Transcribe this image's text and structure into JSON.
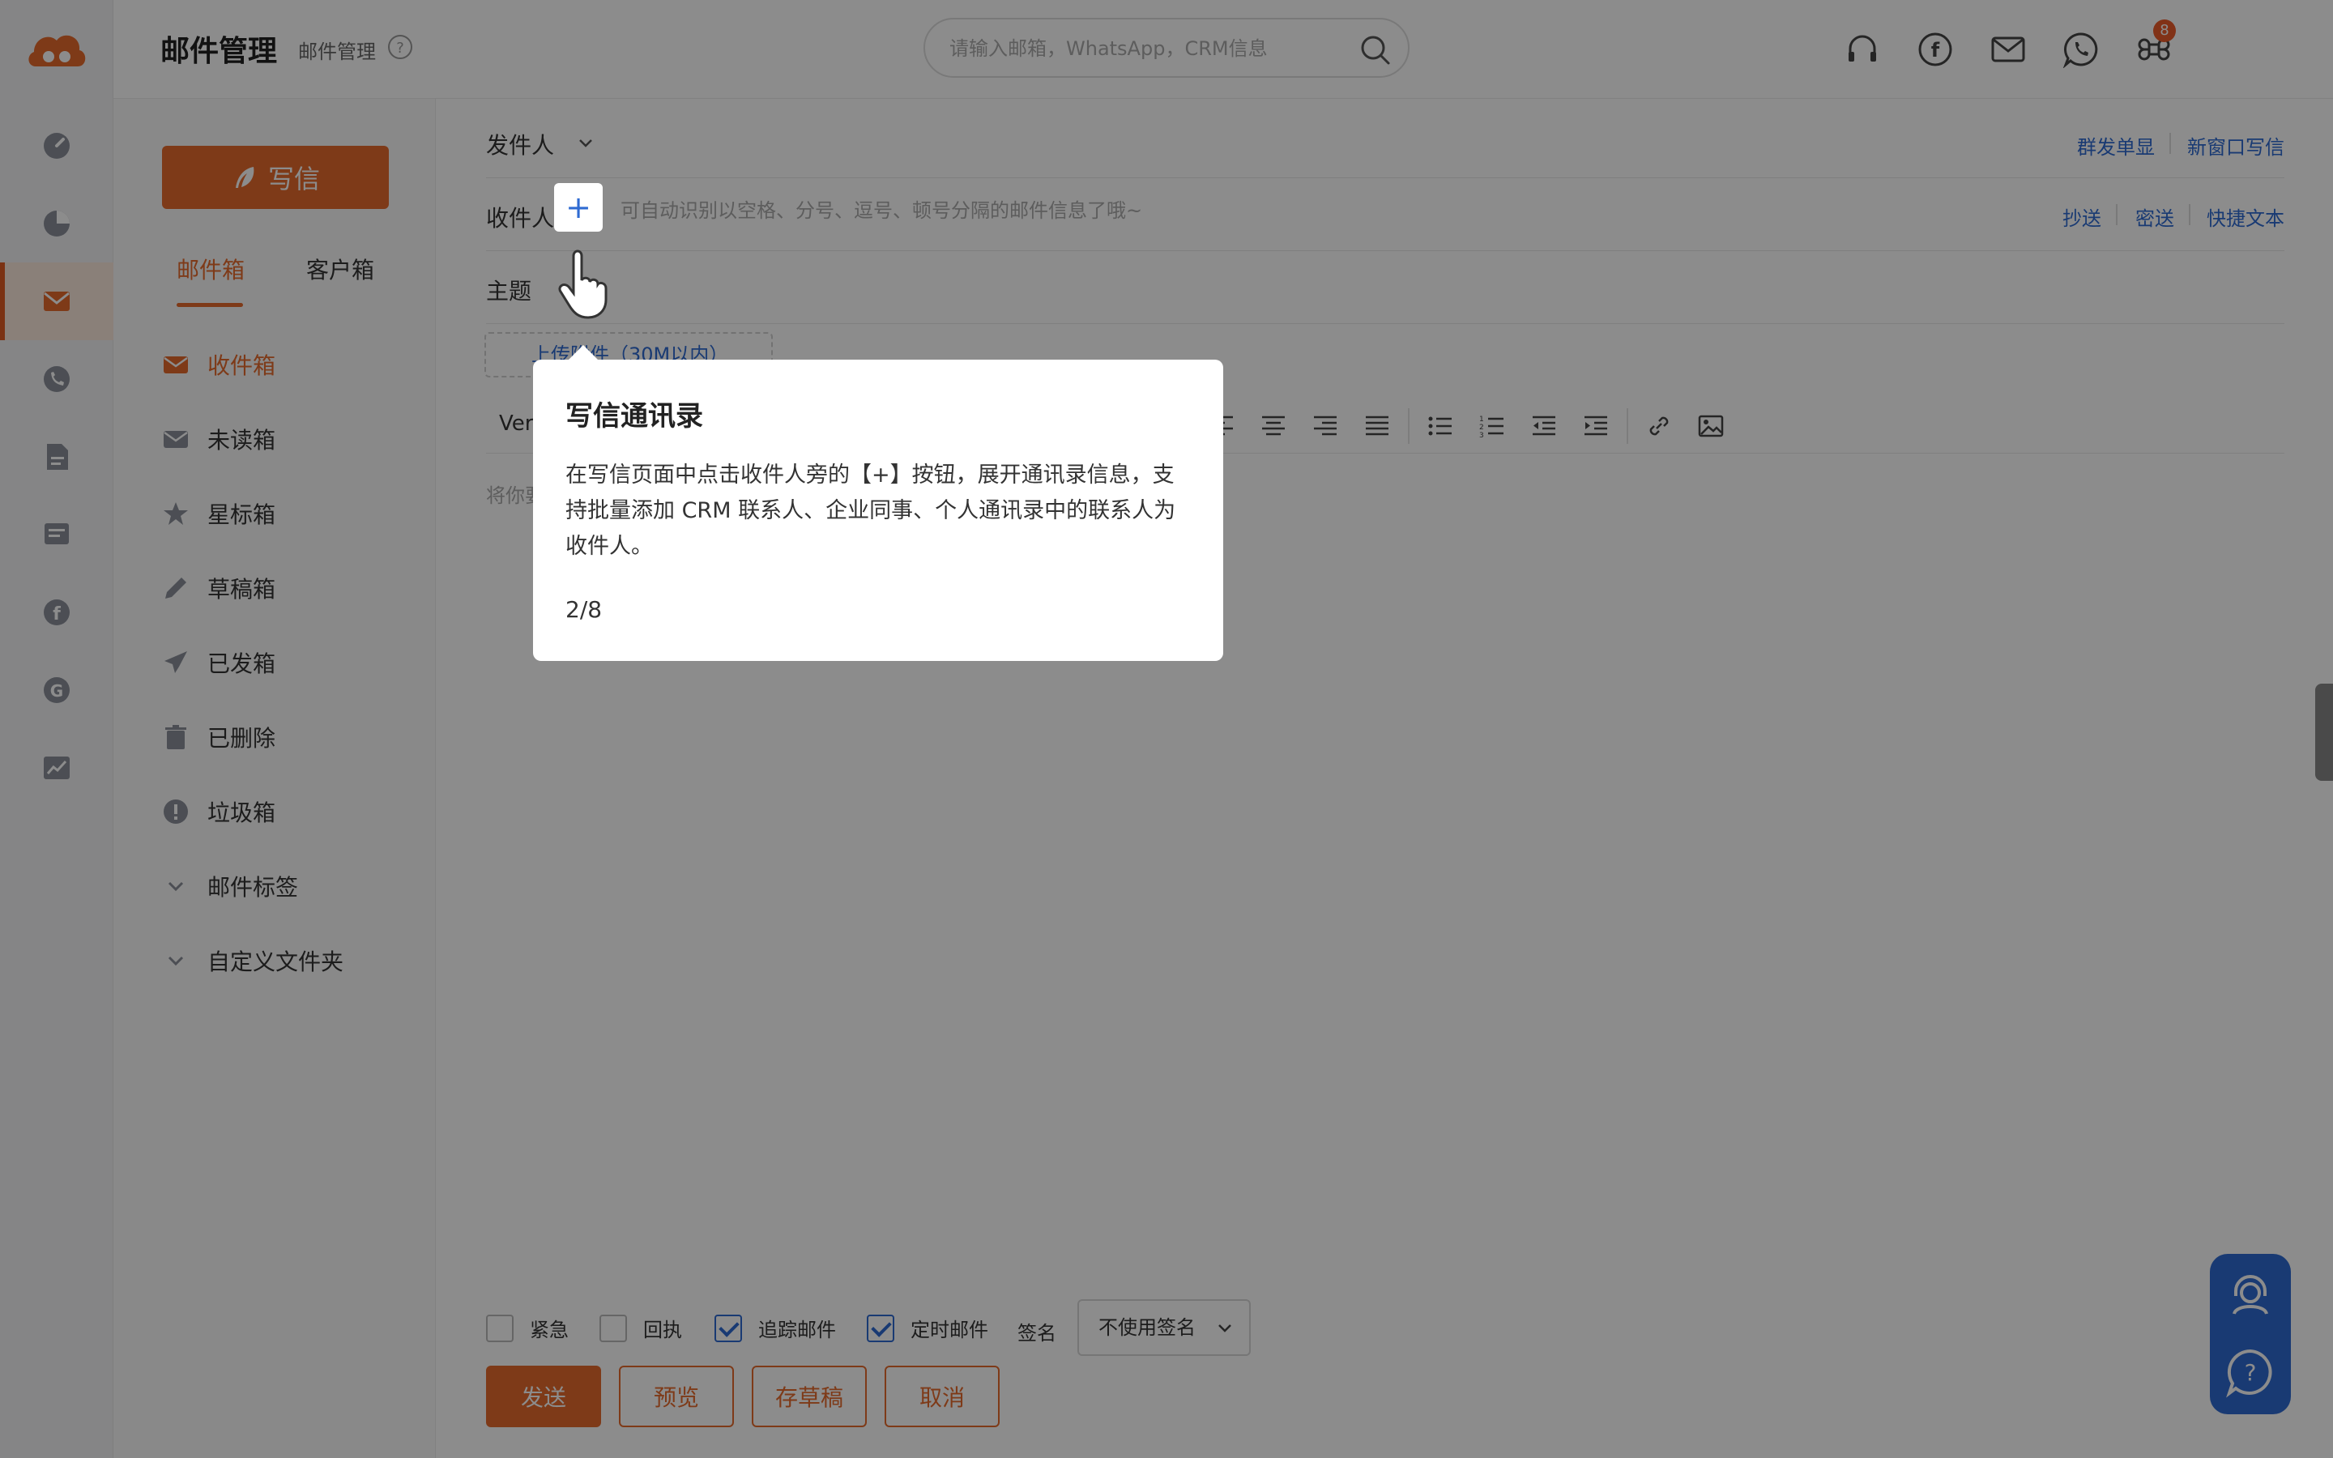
{
  "header": {
    "title": "邮件管理",
    "subtitle": "邮件管理",
    "search_placeholder": "请输入邮箱，WhatsApp，CRM信息",
    "apps_badge": "8"
  },
  "sidebar": {
    "write_label": "写信",
    "tabs": [
      "邮件箱",
      "客户箱"
    ],
    "folders": [
      {
        "label": "收件箱",
        "icon": "inbox-icon"
      },
      {
        "label": "未读箱",
        "icon": "unread-icon"
      },
      {
        "label": "星标箱",
        "icon": "star-icon"
      },
      {
        "label": "草稿箱",
        "icon": "pencil-icon"
      },
      {
        "label": "已发箱",
        "icon": "send-icon"
      },
      {
        "label": "已删除",
        "icon": "trash-icon"
      },
      {
        "label": "垃圾箱",
        "icon": "spam-icon"
      },
      {
        "label": "邮件标签",
        "icon": "chevron-down-icon"
      },
      {
        "label": "自定义文件夹",
        "icon": "chevron-down-icon"
      }
    ]
  },
  "compose": {
    "sender_label": "发件人",
    "mass_send_link": "群发单显",
    "new_window_link": "新窗口写信",
    "recipient_label": "收件人",
    "recipient_hint": "可自动识别以空格、分号、逗号、顿号分隔的邮件信息了哦~",
    "cc_link": "抄送",
    "bcc_link": "密送",
    "quick_text_link": "快捷文本",
    "subject_label": "主题",
    "attach_label": "上传附件（30M以内）",
    "font_label": "Ver",
    "editor_placeholder": "将你要"
  },
  "options": {
    "urgent": "紧急",
    "receipt": "回执",
    "track": "追踪邮件",
    "scheduled": "定时邮件",
    "signature_label": "签名",
    "signature_value": "不使用签名"
  },
  "actions": {
    "send": "发送",
    "preview": "预览",
    "save_draft": "存草稿",
    "cancel": "取消"
  },
  "tooltip": {
    "title": "写信通讯录",
    "body": "在写信页面中点击收件人旁的【+】按钮，展开通讯录信息，支持批量添加 CRM 联系人、企业同事、个人通讯录中的联系人为收件人。",
    "step": "2/8"
  },
  "colors": {
    "brand": "#e56b2d",
    "link": "#2f6bd2"
  }
}
